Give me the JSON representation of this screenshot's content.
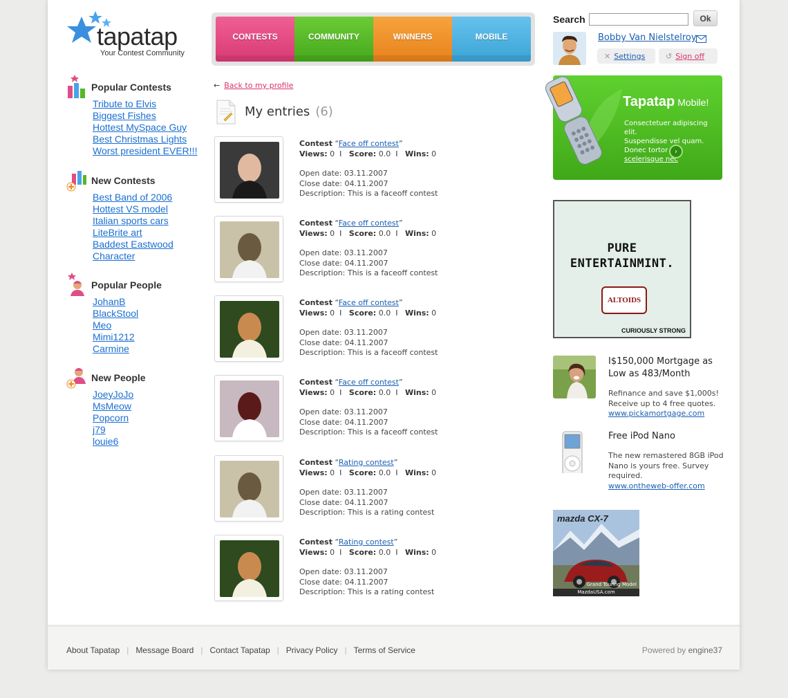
{
  "brand": {
    "name": "tapatap",
    "tagline": "Your Contest Community"
  },
  "nav": {
    "tabs": [
      {
        "label": "CONTESTS",
        "color": "#e5487f"
      },
      {
        "label": "COMMUNITY",
        "color": "#55b827"
      },
      {
        "label": "WINNERS",
        "color": "#f08d26"
      },
      {
        "label": "MOBILE",
        "color": "#4cb0e0"
      }
    ]
  },
  "search": {
    "label": "Search",
    "value": "",
    "button": "Ok"
  },
  "user": {
    "name": "Bobby Van Nielstelroy",
    "settings": "Settings",
    "signoff": "Sign off"
  },
  "sidebar": {
    "popular_contests": {
      "title": "Popular Contests",
      "items": [
        "Tribute to Elvis",
        "Biggest Fishes",
        "Hottest MySpace Guy",
        "Best Christmas Lights",
        "Worst president EVER!!!"
      ]
    },
    "new_contests": {
      "title": "New Contests",
      "items": [
        "Best Band of 2006",
        "Hottest VS model",
        "Italian sports cars",
        "LiteBrite art",
        "Baddest Eastwood ",
        "Character"
      ]
    },
    "popular_people": {
      "title": "Popular People",
      "items": [
        "JohanB",
        "BlackStool",
        "Meo",
        "Mimi1212",
        "Carmine"
      ]
    },
    "new_people": {
      "title": "New People",
      "items": [
        "JoeyJoJo",
        "MsMeow",
        "Popcorn",
        "j79",
        "louie6"
      ]
    }
  },
  "main": {
    "back_link": "Back to my profile",
    "title": "My entries",
    "count": "(6)",
    "labels": {
      "contest": "Contest",
      "views": "Views:",
      "score": "Score:",
      "wins": "Wins:",
      "open": "Open date:",
      "close": "Close date:",
      "description": "Description:"
    },
    "entries": [
      {
        "contest": "Face off contest",
        "views": "0",
        "score": "0.0",
        "wins": "0",
        "open": "03.11.2007",
        "close": "04.11.2007",
        "description": "This is a faceoff contest"
      },
      {
        "contest": "Face off contest",
        "views": "0",
        "score": "0.0",
        "wins": "0",
        "open": "03.11.2007",
        "close": "04.11.2007",
        "description": "This is a faceoff contest"
      },
      {
        "contest": "Face off contest",
        "views": "0",
        "score": "0.0",
        "wins": "0",
        "open": "03.11.2007",
        "close": "04.11.2007",
        "description": "This is a faceoff contest"
      },
      {
        "contest": "Face off contest",
        "views": "0",
        "score": "0.0",
        "wins": "0",
        "open": "03.11.2007",
        "close": "04.11.2007",
        "description": "This is a faceoff contest"
      },
      {
        "contest": "Rating contest",
        "views": "0",
        "score": "0.0",
        "wins": "0",
        "open": "03.11.2007",
        "close": "04.11.2007",
        "description": "This is a rating contest"
      },
      {
        "contest": "Rating contest",
        "views": "0",
        "score": "0.0",
        "wins": "0",
        "open": "03.11.2007",
        "close": "04.11.2007",
        "description": "This is a rating contest"
      }
    ]
  },
  "mobile_promo": {
    "title": "Tapatap",
    "title_suffix": "Mobile!",
    "lines": [
      "Consectetuer adipiscing elit.",
      "Suspendisse vel quam.",
      "Donec tortor"
    ],
    "link": "scelerisque nec",
    "go": "›"
  },
  "ads": {
    "altoids": {
      "line1": "PURE",
      "line2": "ENTERTAINMINT.",
      "brand": "ALTOIDS",
      "slogan": "CURIOUSLY STRONG"
    },
    "mortgage": {
      "title": "I$150,000 Mortgage as Low as 483/Month",
      "body": "Refinance and save $1,000s! Receive up to 4 free quotes.",
      "link": "www.pickamortgage.com"
    },
    "ipod": {
      "title": "Free iPod Nano",
      "body": "The new remastered 8GB iPod Nano is yours free. Survey required.",
      "link": "www.ontheweb-offer.com"
    },
    "mazda": {
      "logo": "mazda CX-7",
      "caption": "Grand Touring Model",
      "footer": "MazdaUSA.com"
    }
  },
  "footer": {
    "links": [
      "About Tapatap",
      "Message Board",
      "Contact Tapatap",
      "Privacy Policy",
      "Terms of Service"
    ],
    "powered_prefix": "Powered by",
    "powered_brand": "engine37"
  }
}
